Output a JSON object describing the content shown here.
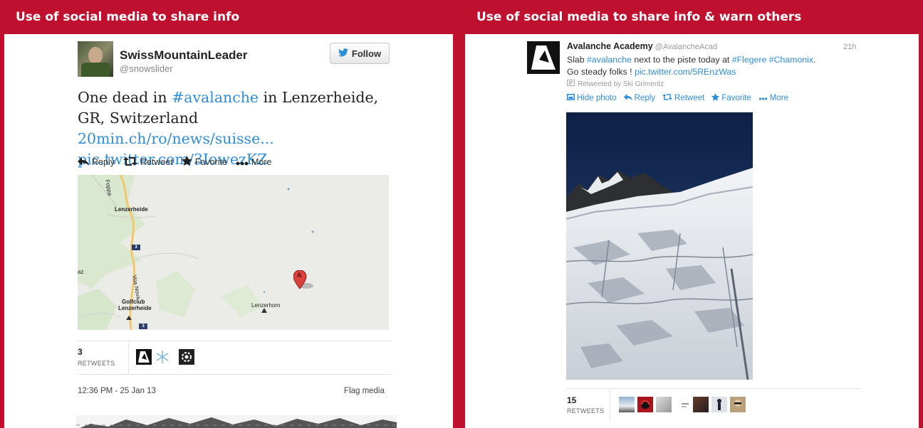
{
  "left": {
    "header": "Use of social media to share info",
    "tweet": {
      "username": "SwissMountainLeader",
      "handle": "@snowslider",
      "follow_label": "Follow",
      "text_plain": "One dead in ",
      "text_hashtag": "#avalanche",
      "text_mid": " in Lenzerheide, GR, Switzerland ",
      "text_link1": "20min.ch/ro/news/suisse...",
      "text_link2": "pic.twitter.com/3IowezKZ",
      "actions": [
        "Reply",
        "Retweet",
        "Favorite",
        "More"
      ],
      "map_labels": {
        "town": "Lenzerheide",
        "golf1": "Golfclub",
        "golf2": "Lenzerheide",
        "peak": "Lenzerhorn",
        "road": "Voa Nova",
        "road2": "Foppa",
        "shield": "3",
        "marker": "A",
        "edge": "az"
      },
      "retweet_count": "3",
      "retweets_label": "RETWEETS",
      "timestamp": "12:36 PM - 25 Jan 13",
      "flag_media": "Flag media"
    }
  },
  "right": {
    "header": "Use of social media to share info & warn others",
    "tweet": {
      "name": "Avalanche Academy",
      "handle": "@AvalancheAcad",
      "time": "21h",
      "text_1": "Slab ",
      "hashtag_avalanche": "#avalanche",
      "text_2": " next to the piste today at ",
      "hashtag_flegere": "#Flegere",
      "hashtag_chamonix": "#Chamonix",
      "text_3": ".",
      "text_4": "Go steady folks ! ",
      "link": "pic.twitter.com/5REnzWas",
      "retweeted_by": "Retweeted by Ski Grimentz",
      "actions": [
        "Hide photo",
        "Reply",
        "Retweet",
        "Favorite",
        "More"
      ],
      "retweet_count": "15",
      "retweets_label": "RETWEETS"
    }
  },
  "colors": {
    "accent": "#c0102f",
    "link": "#2f8ed8"
  },
  "icons": [
    "twitter-bird-icon",
    "reply-icon",
    "retweet-icon",
    "favorite-star-icon",
    "more-dots-icon",
    "photo-icon",
    "map-marker-icon"
  ]
}
